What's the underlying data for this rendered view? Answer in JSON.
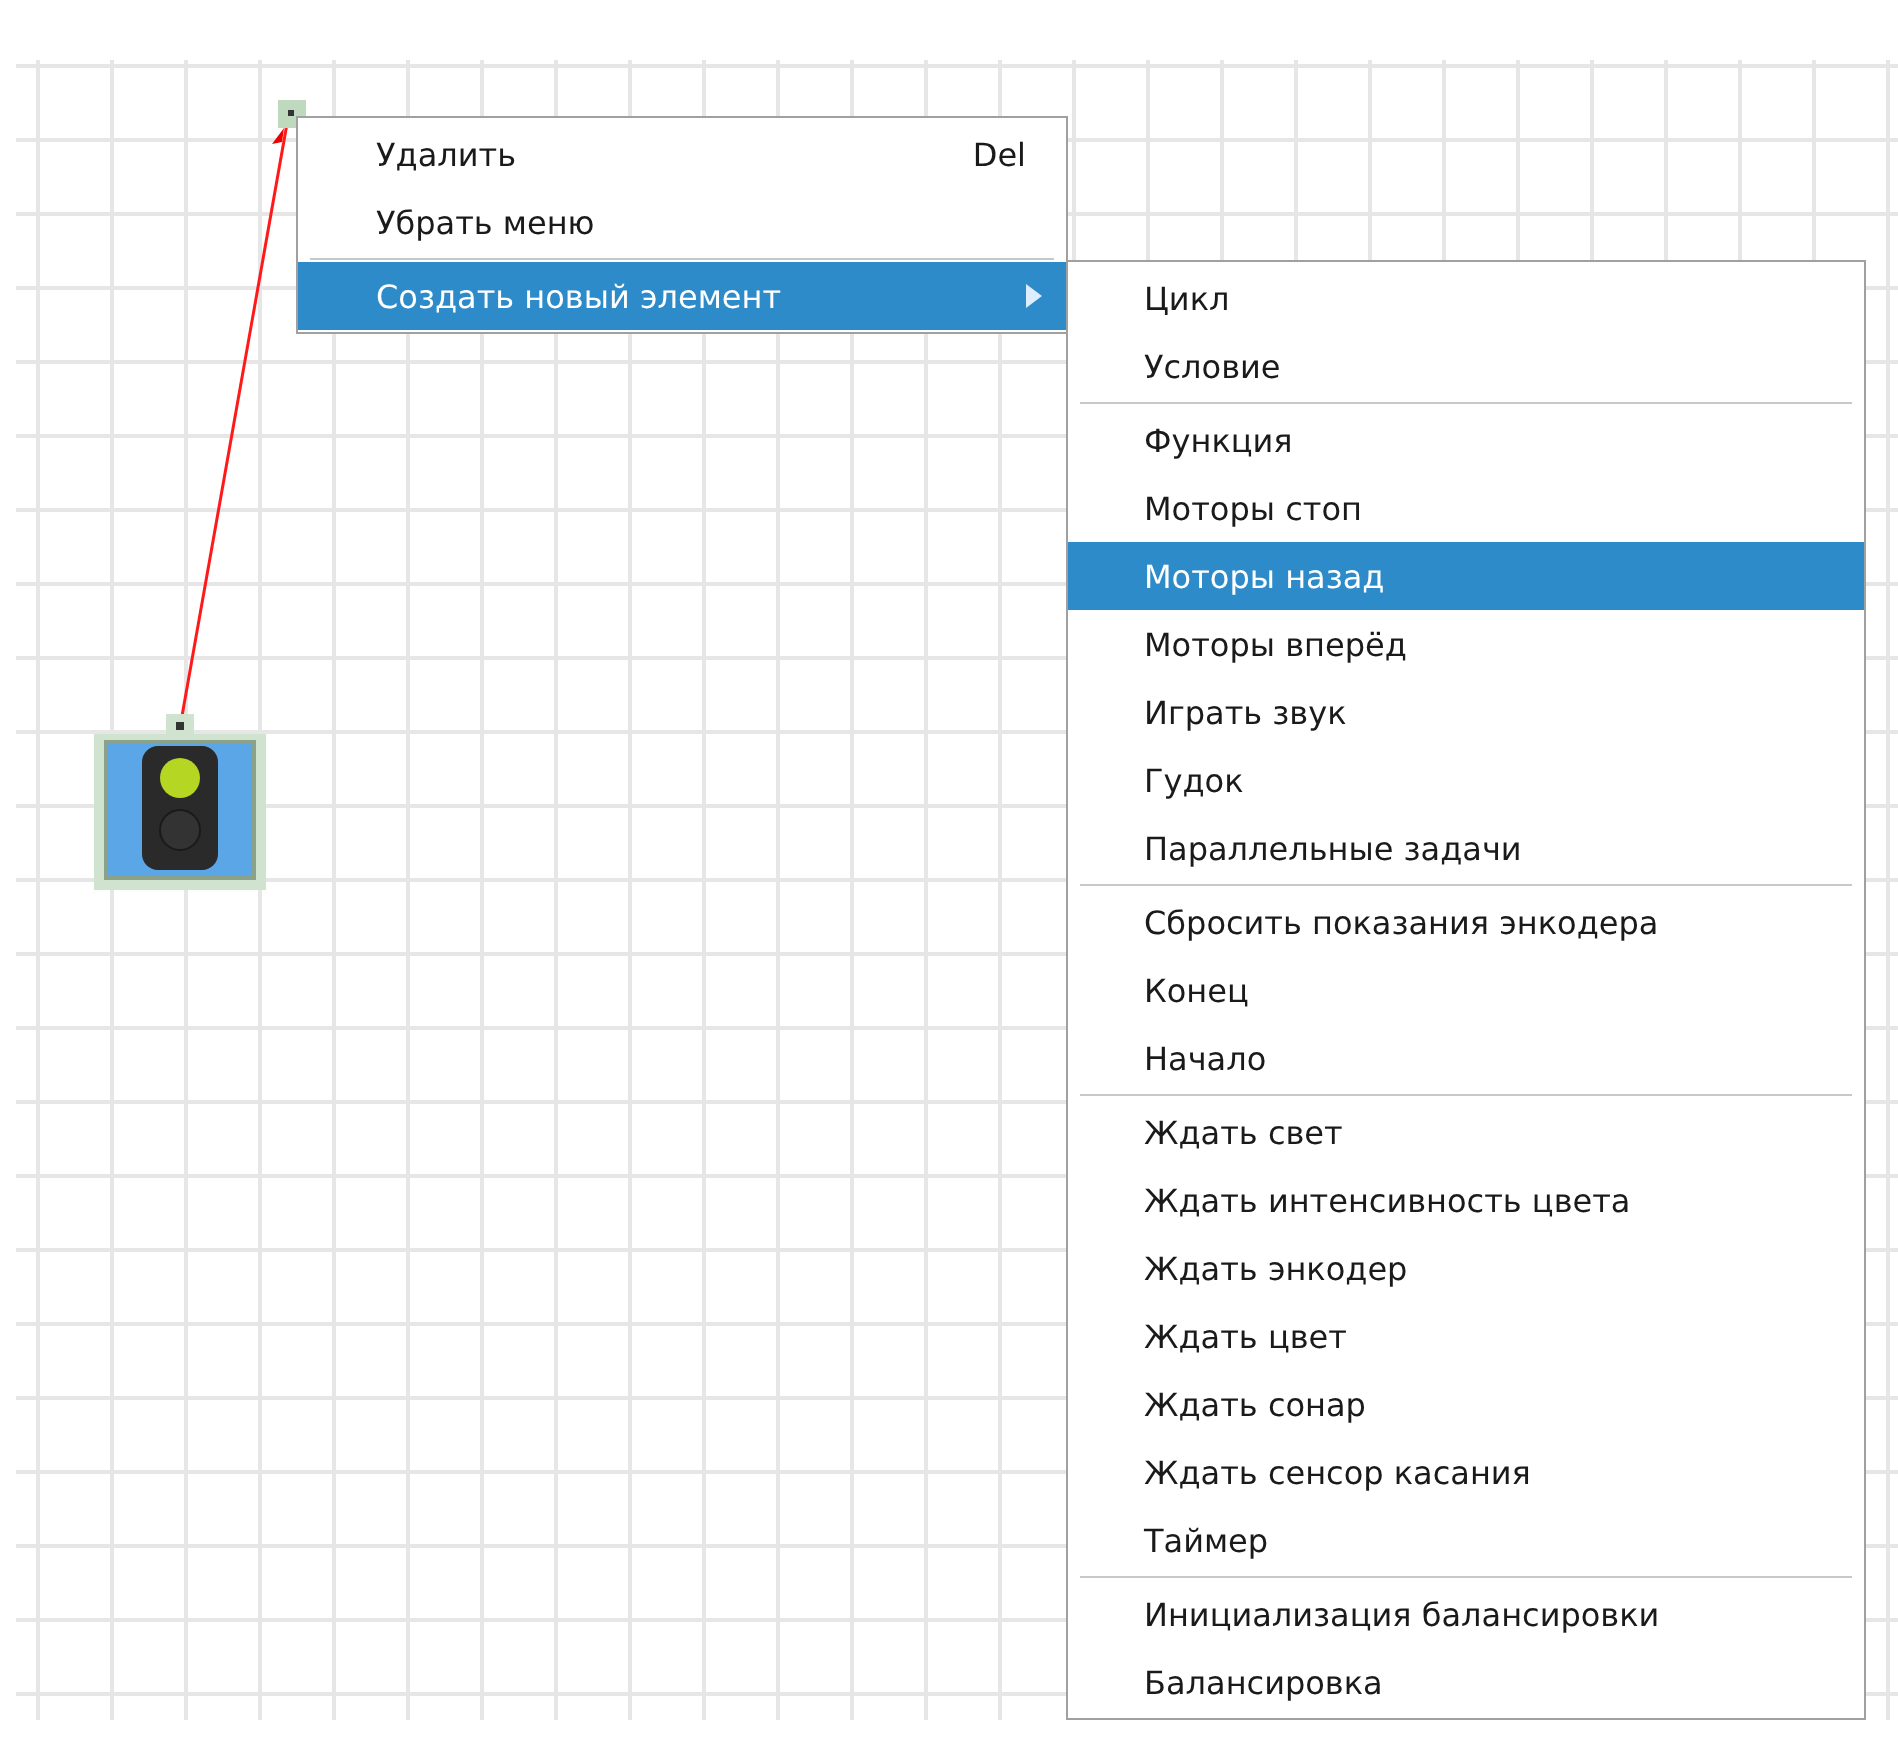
{
  "context_menu": {
    "groups": [
      [
        {
          "label": "Удалить",
          "shortcut": "Del",
          "kind": "action",
          "selected": false
        },
        {
          "label": "Убрать меню",
          "kind": "action",
          "selected": false
        }
      ],
      [
        {
          "label": "Создать новый элемент",
          "kind": "submenu",
          "selected": true
        }
      ]
    ]
  },
  "submenu": {
    "groups": [
      [
        {
          "label": "Цикл",
          "selected": false
        },
        {
          "label": "Условие",
          "selected": false
        }
      ],
      [
        {
          "label": "Функция",
          "selected": false
        },
        {
          "label": "Моторы стоп",
          "selected": false
        },
        {
          "label": "Моторы назад",
          "selected": true
        },
        {
          "label": "Моторы вперёд",
          "selected": false
        },
        {
          "label": "Играть звук",
          "selected": false
        },
        {
          "label": "Гудок",
          "selected": false
        },
        {
          "label": "Параллельные задачи",
          "selected": false
        }
      ],
      [
        {
          "label": "Сбросить показания энкодера",
          "selected": false
        },
        {
          "label": "Конец",
          "selected": false
        },
        {
          "label": "Начало",
          "selected": false
        }
      ],
      [
        {
          "label": "Ждать свет",
          "selected": false
        },
        {
          "label": "Ждать интенсивность цвета",
          "selected": false
        },
        {
          "label": "Ждать энкодер",
          "selected": false
        },
        {
          "label": "Ждать цвет",
          "selected": false
        },
        {
          "label": "Ждать сонар",
          "selected": false
        },
        {
          "label": "Ждать сенсор касания",
          "selected": false
        },
        {
          "label": "Таймер",
          "selected": false
        }
      ],
      [
        {
          "label": "Инициализация балансировки",
          "selected": false
        },
        {
          "label": "Балансировка",
          "selected": false
        }
      ]
    ]
  }
}
